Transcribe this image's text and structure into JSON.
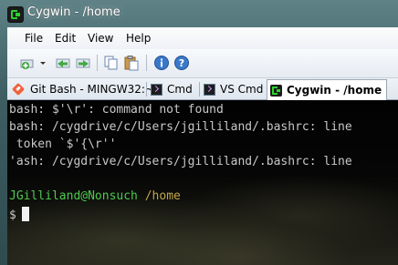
{
  "window": {
    "title": "Cygwin - /home"
  },
  "menu": {
    "items": [
      "File",
      "Edit",
      "View",
      "Help"
    ]
  },
  "toolbar": {
    "icons": [
      "new-tab-icon",
      "dropdown-arrow-icon",
      "back-icon",
      "forward-icon",
      "copy-icon",
      "paste-icon",
      "info-icon",
      "help-icon"
    ]
  },
  "tabs": [
    {
      "label": "Git Bash - MINGW32:~",
      "icon": "git-icon"
    },
    {
      "label": "Cmd",
      "icon": "terminal-icon"
    },
    {
      "label": "VS Cmd",
      "icon": "terminal-icon"
    },
    {
      "label": "Cygwin - /home",
      "icon": "cygwin-icon",
      "active": true
    }
  ],
  "console": {
    "lines": [
      "bash: $'\\r': command not found",
      "bash: /cygdrive/c/Users/jgilliland/.bashrc: line",
      " token `$'{\\r''",
      "'ash: /cygdrive/c/Users/jgilliland/.bashrc: line"
    ],
    "prompt_user": "JGilliland@Nonsuch",
    "prompt_path": "/home",
    "prompt_symbol": "$"
  },
  "colors": {
    "prompt_user": "#4ec94e",
    "prompt_path": "#c2a64a",
    "active_tab_bg": "#ffffff"
  }
}
